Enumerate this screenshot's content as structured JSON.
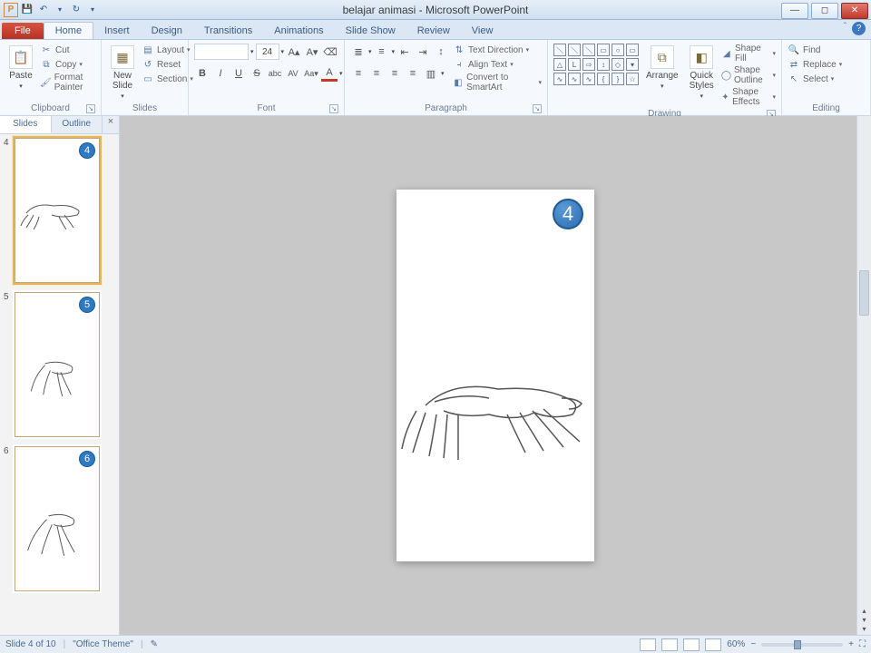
{
  "title": "belajar animasi  -  Microsoft PowerPoint",
  "qat": {
    "save": "💾",
    "undo": "↶",
    "redo": "↻"
  },
  "tabs": {
    "file": "File",
    "home": "Home",
    "insert": "Insert",
    "design": "Design",
    "transitions": "Transitions",
    "animations": "Animations",
    "slideshow": "Slide Show",
    "review": "Review",
    "view": "View"
  },
  "ribbon": {
    "clipboard": {
      "paste": "Paste",
      "cut": "Cut",
      "copy": "Copy",
      "painter": "Format Painter",
      "label": "Clipboard"
    },
    "slides": {
      "new": "New\nSlide",
      "layout": "Layout",
      "reset": "Reset",
      "section": "Section",
      "label": "Slides"
    },
    "font": {
      "size": "24",
      "label": "Font"
    },
    "paragraph": {
      "textdir": "Text Direction",
      "align": "Align Text",
      "smartart": "Convert to SmartArt",
      "label": "Paragraph"
    },
    "drawing": {
      "arrange": "Arrange",
      "quick": "Quick\nStyles",
      "fill": "Shape Fill",
      "outline": "Shape Outline",
      "effects": "Shape Effects",
      "label": "Drawing"
    },
    "editing": {
      "find": "Find",
      "replace": "Replace",
      "select": "Select",
      "label": "Editing"
    }
  },
  "panel": {
    "slides": "Slides",
    "outline": "Outline"
  },
  "thumbs": [
    {
      "num": "4",
      "badge": "4",
      "selected": true
    },
    {
      "num": "5",
      "badge": "5",
      "selected": false
    },
    {
      "num": "6",
      "badge": "6",
      "selected": false
    }
  ],
  "slide": {
    "badge": "4"
  },
  "status": {
    "pos": "Slide 4 of 10",
    "theme": "\"Office Theme\"",
    "zoom": "60%"
  }
}
